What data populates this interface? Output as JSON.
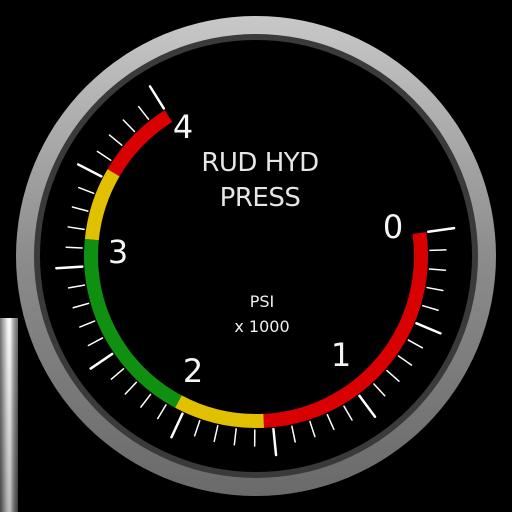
{
  "gauge": {
    "title_line1": "RUD HYD",
    "title_line2": "PRESS",
    "unit_line1": "PSI",
    "unit_line2": "x 1000",
    "scale_labels": [
      "0",
      "1",
      "2",
      "3",
      "4"
    ],
    "scale_min": 0,
    "scale_max": 4,
    "colors": {
      "red": "#d80000",
      "yellow": "#e0c000",
      "green": "#109010",
      "bezel": "#8a8a8a",
      "face": "#000000",
      "tick": "#ffffff"
    },
    "bands": [
      {
        "from": 0.0,
        "to": 1.55,
        "color": "red"
      },
      {
        "from": 1.55,
        "to": 2.05,
        "color": "yellow"
      },
      {
        "from": 2.05,
        "to": 3.15,
        "color": "green"
      },
      {
        "from": 3.15,
        "to": 3.55,
        "color": "yellow"
      },
      {
        "from": 3.55,
        "to": 4.0,
        "color": "red"
      }
    ]
  }
}
